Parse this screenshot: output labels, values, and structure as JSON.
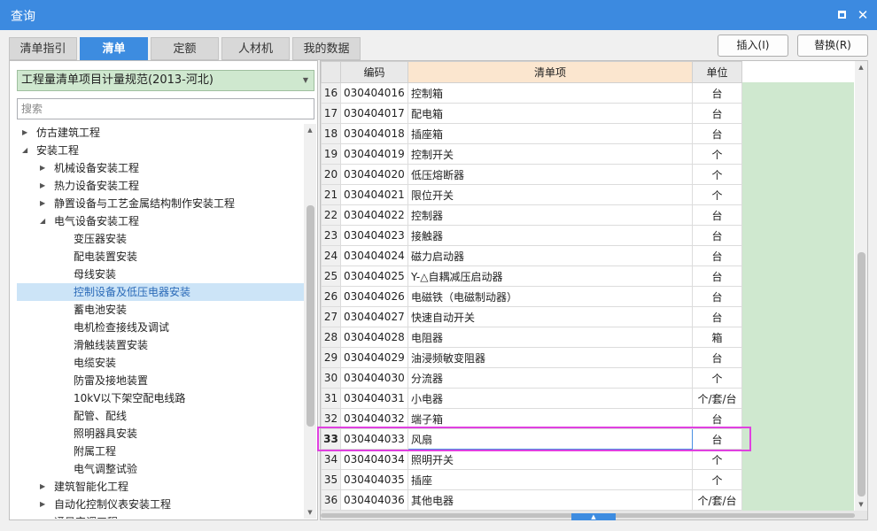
{
  "window": {
    "title": "查询",
    "max_icon": "maximize-icon",
    "close_icon": "close-icon",
    "close_glyph": "✕"
  },
  "tabs": [
    {
      "label": "清单指引",
      "active": false
    },
    {
      "label": "清单",
      "active": true
    },
    {
      "label": "定额",
      "active": false
    },
    {
      "label": "人材机",
      "active": false
    },
    {
      "label": "我的数据",
      "active": false
    }
  ],
  "buttons": {
    "insert": "插入(I)",
    "replace": "替换(R)"
  },
  "combo": {
    "value": "工程量清单项目计量规范(2013-河北)"
  },
  "search": {
    "placeholder": "搜索"
  },
  "tree": [
    {
      "label": "仿古建筑工程",
      "level": 0,
      "expander": "right"
    },
    {
      "label": "安装工程",
      "level": 0,
      "expander": "down"
    },
    {
      "label": "机械设备安装工程",
      "level": 1,
      "expander": "right"
    },
    {
      "label": "热力设备安装工程",
      "level": 1,
      "expander": "right"
    },
    {
      "label": "静置设备与工艺金属结构制作安装工程",
      "level": 1,
      "expander": "right"
    },
    {
      "label": "电气设备安装工程",
      "level": 1,
      "expander": "down"
    },
    {
      "label": "变压器安装",
      "level": 2
    },
    {
      "label": "配电装置安装",
      "level": 2
    },
    {
      "label": "母线安装",
      "level": 2
    },
    {
      "label": "控制设备及低压电器安装",
      "level": 2,
      "selected": true
    },
    {
      "label": "蓄电池安装",
      "level": 2
    },
    {
      "label": "电机检查接线及调试",
      "level": 2
    },
    {
      "label": "滑触线装置安装",
      "level": 2
    },
    {
      "label": "电缆安装",
      "level": 2
    },
    {
      "label": "防雷及接地装置",
      "level": 2
    },
    {
      "label": "10kV以下架空配电线路",
      "level": 2
    },
    {
      "label": "配管、配线",
      "level": 2
    },
    {
      "label": "照明器具安装",
      "level": 2
    },
    {
      "label": "附属工程",
      "level": 2
    },
    {
      "label": "电气调整试验",
      "level": 2
    },
    {
      "label": "建筑智能化工程",
      "level": 1,
      "expander": "right"
    },
    {
      "label": "自动化控制仪表安装工程",
      "level": 1,
      "expander": "right"
    },
    {
      "label": "通风空调工程",
      "level": 1,
      "expander": "right"
    }
  ],
  "grid": {
    "headers": {
      "code": "编码",
      "name": "清单项",
      "unit": "单位"
    },
    "rows": [
      {
        "no": "16",
        "code": "030404016",
        "name": "控制箱",
        "unit": "台"
      },
      {
        "no": "17",
        "code": "030404017",
        "name": "配电箱",
        "unit": "台"
      },
      {
        "no": "18",
        "code": "030404018",
        "name": "插座箱",
        "unit": "台"
      },
      {
        "no": "19",
        "code": "030404019",
        "name": "控制开关",
        "unit": "个"
      },
      {
        "no": "20",
        "code": "030404020",
        "name": "低压熔断器",
        "unit": "个"
      },
      {
        "no": "21",
        "code": "030404021",
        "name": "限位开关",
        "unit": "个"
      },
      {
        "no": "22",
        "code": "030404022",
        "name": "控制器",
        "unit": "台"
      },
      {
        "no": "23",
        "code": "030404023",
        "name": "接触器",
        "unit": "台"
      },
      {
        "no": "24",
        "code": "030404024",
        "name": "磁力启动器",
        "unit": "台"
      },
      {
        "no": "25",
        "code": "030404025",
        "name": "Y-△自耦减压启动器",
        "unit": "台"
      },
      {
        "no": "26",
        "code": "030404026",
        "name": "电磁铁（电磁制动器）",
        "unit": "台"
      },
      {
        "no": "27",
        "code": "030404027",
        "name": "快速自动开关",
        "unit": "台"
      },
      {
        "no": "28",
        "code": "030404028",
        "name": "电阻器",
        "unit": "箱"
      },
      {
        "no": "29",
        "code": "030404029",
        "name": "油浸频敏变阻器",
        "unit": "台"
      },
      {
        "no": "30",
        "code": "030404030",
        "name": "分流器",
        "unit": "个"
      },
      {
        "no": "31",
        "code": "030404031",
        "name": "小电器",
        "unit": "个/套/台"
      },
      {
        "no": "32",
        "code": "030404032",
        "name": "端子箱",
        "unit": "台"
      },
      {
        "no": "33",
        "code": "030404033",
        "name": "风扇",
        "unit": "台",
        "current": true
      },
      {
        "no": "34",
        "code": "030404034",
        "name": "照明开关",
        "unit": "个"
      },
      {
        "no": "35",
        "code": "030404035",
        "name": "插座",
        "unit": "个"
      },
      {
        "no": "36",
        "code": "030404036",
        "name": "其他电器",
        "unit": "个/套/台"
      }
    ]
  },
  "colors": {
    "accent": "#3d8ce0",
    "highlight": "#e040e0",
    "unit_area": "#cfe8cf",
    "header_highlight": "#fbe6cf",
    "selected_tree": "#cce4f7"
  }
}
